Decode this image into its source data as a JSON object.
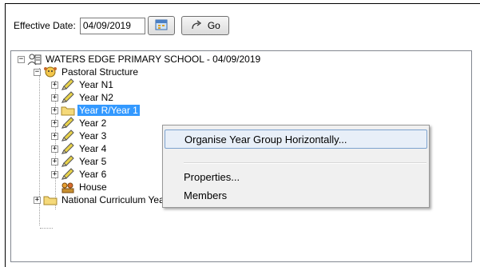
{
  "toolbar": {
    "effective_date_label": "Effective Date:",
    "effective_date_value": "04/09/2019",
    "calendar_icon": "calendar-icon",
    "go_label": "Go",
    "go_icon": "go-arrow-icon"
  },
  "tree": {
    "root": "WATERS EDGE PRIMARY SCHOOL - 04/09/2019",
    "pastoral": "Pastoral Structure",
    "years": [
      "Year  N1",
      "Year  N2",
      "Year  R/Year  1",
      "Year  2",
      "Year  3",
      "Year  4",
      "Year  5",
      "Year  6"
    ],
    "selected_index": 2,
    "house": "House",
    "national": "National Curriculum Year Taught In"
  },
  "context_menu": {
    "items": [
      "Organise Year Group Horizontally...",
      "Properties...",
      "Members"
    ],
    "highlighted_index": 0
  },
  "colors": {
    "selection": "#3399ff",
    "menu_bg": "#f0f0f0",
    "menu_highlight_border": "#7da2ce"
  }
}
